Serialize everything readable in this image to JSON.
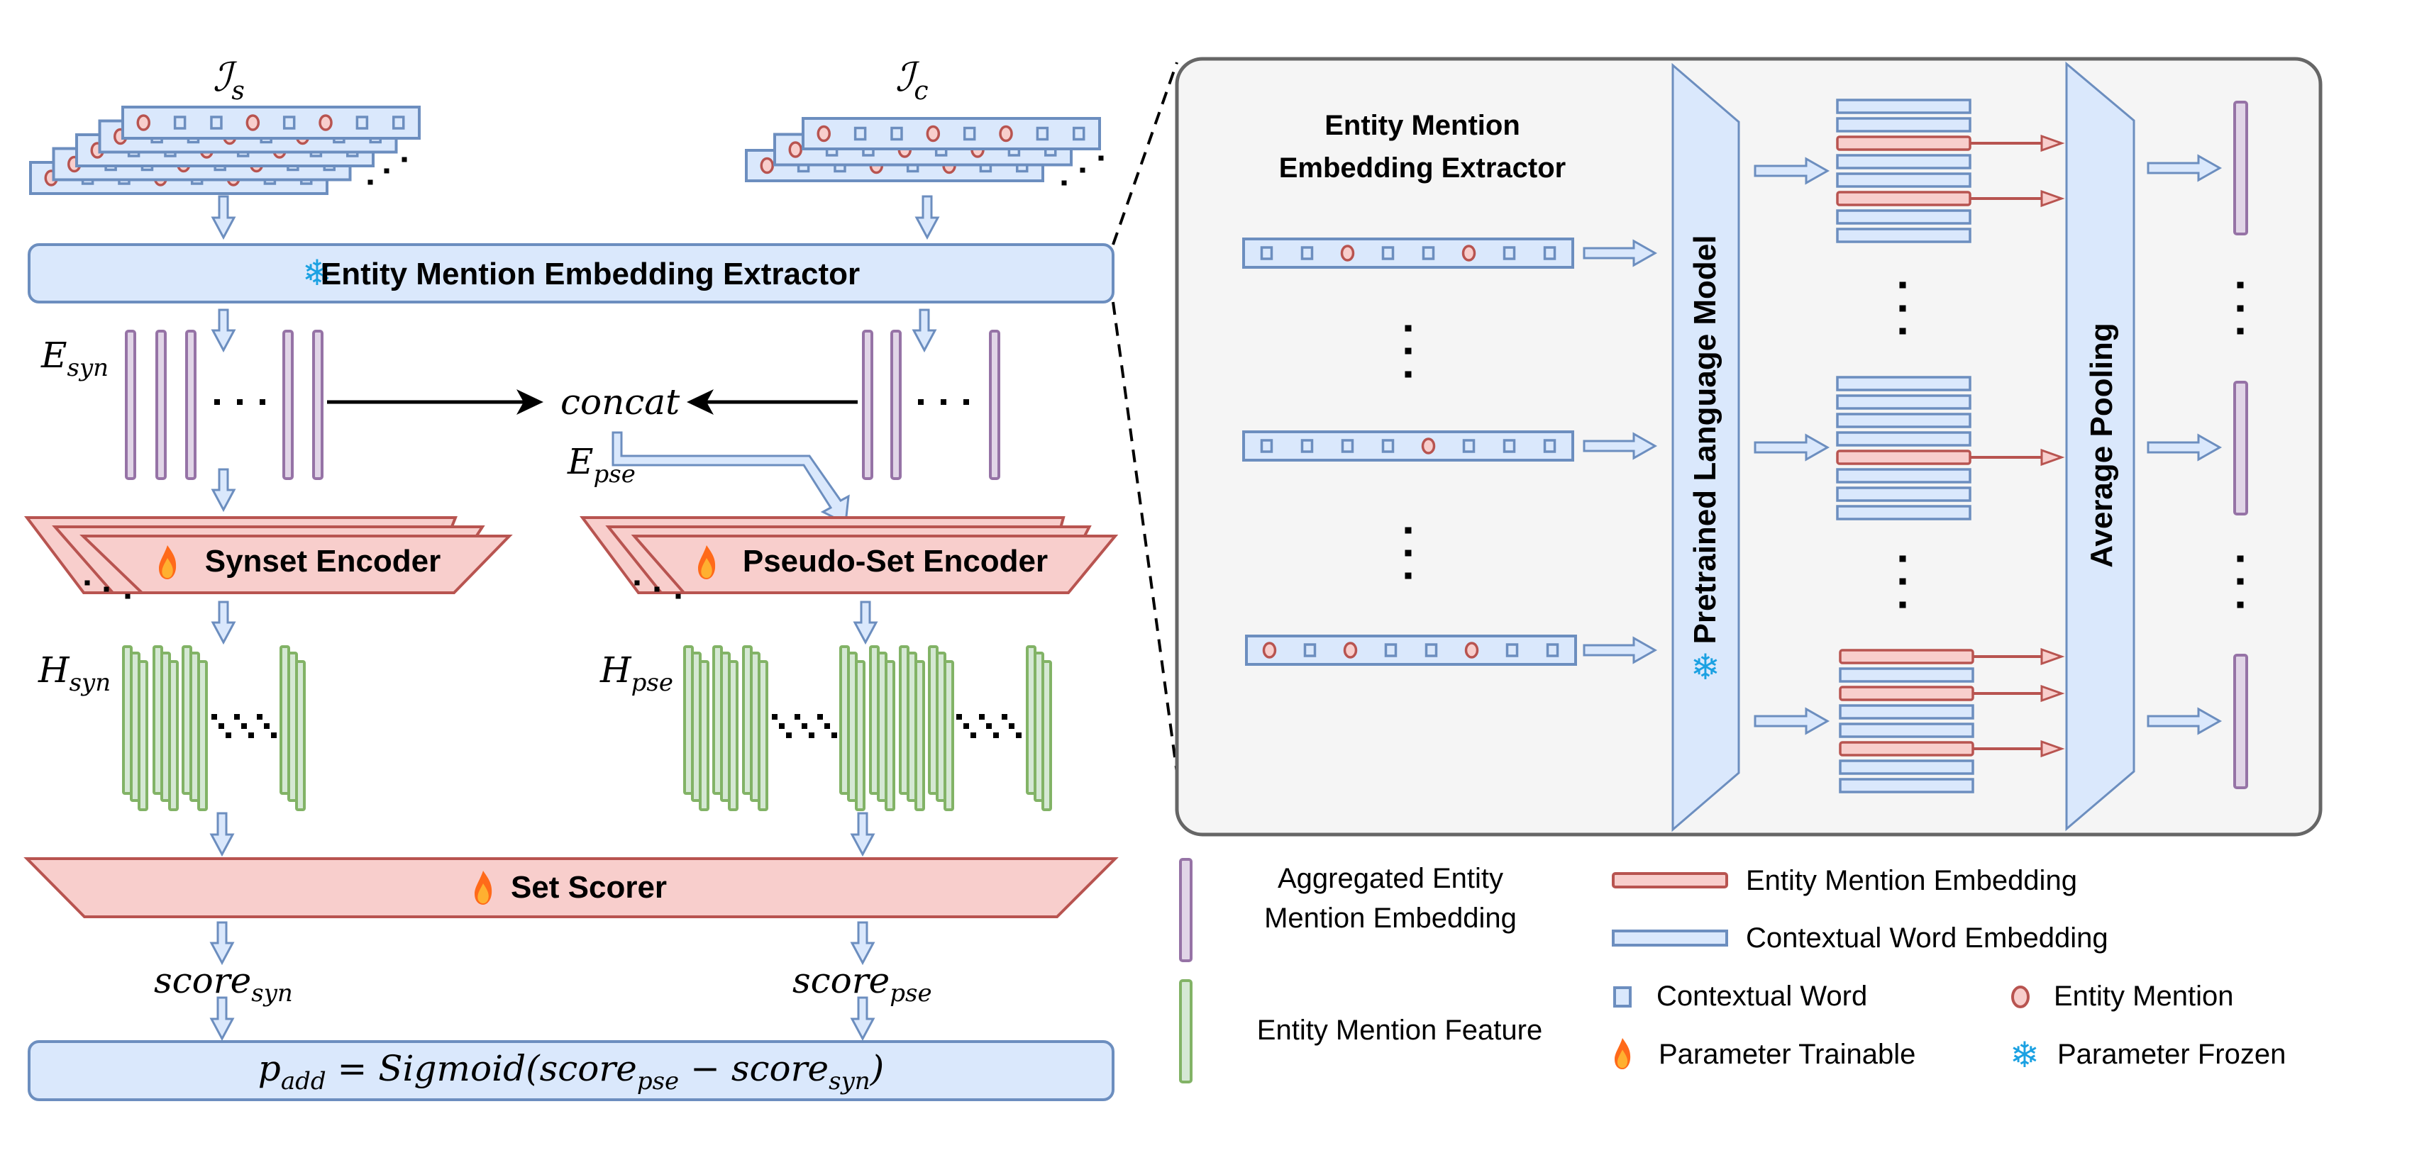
{
  "colors": {
    "blue_fill": "#dae8fc",
    "blue_stroke": "#6c8ebf",
    "red_fill": "#f8cecc",
    "red_stroke": "#b85450",
    "purple_fill": "#e1d5e7",
    "purple_stroke": "#9673a6",
    "green_fill": "#d5e8d4",
    "green_stroke": "#82b366",
    "panel_fill": "#f5f5f5",
    "panel_stroke": "#666666",
    "frozen": "#1ba1e2",
    "fire_outer": "#ff6a1a",
    "fire_inner": "#ffb030"
  },
  "icons": {
    "frozen": "snowflake-icon",
    "trainable": "fire-icon",
    "snowflake_glyph": "❄"
  },
  "inputs": {
    "synset": {
      "base": "ℐ",
      "sub": "s",
      "cards": 5,
      "pattern": "csscscss"
    },
    "candidate": {
      "base": "ℐ",
      "sub": "c",
      "cards": 3,
      "pattern": "csscscss"
    }
  },
  "extractor": {
    "label": "Entity Mention Embedding Extractor"
  },
  "labels": {
    "e_syn": {
      "base": "E",
      "sub": "syn"
    },
    "e_pse": {
      "base": "E",
      "sub": "pse"
    },
    "concat": "concat",
    "h_syn": {
      "base": "H",
      "sub": "syn"
    },
    "h_pse": {
      "base": "H",
      "sub": "pse"
    },
    "score_syn": {
      "base": "score",
      "sub": "syn"
    },
    "score_pse": {
      "base": "score",
      "sub": "pse"
    }
  },
  "synset_encoder": {
    "label": "Synset Encoder"
  },
  "pseudo_encoder": {
    "label": "Pseudo-Set Encoder"
  },
  "set_scorer": {
    "label": "Set Scorer"
  },
  "formula": {
    "p": "p",
    "p_sub": "add",
    "mid": " = Sigmoid(score",
    "s1_sub": "pse",
    "minus": " − score",
    "s2_sub": "syn",
    "end": ")"
  },
  "detail_panel": {
    "title_line1": "Entity Mention",
    "title_line2": "Embedding Extractor",
    "sentences": [
      "sscsscss",
      "sssscsss",
      "cscsscss"
    ],
    "plm_label": "Pretrained Language Model",
    "pool_label": "Average Pooling",
    "token_groups": [
      {
        "rows": 8,
        "mentions": [
          2,
          5
        ]
      },
      {
        "rows": 8,
        "mentions": [
          4
        ]
      },
      {
        "rows": 8,
        "mentions": [
          0,
          2,
          5
        ]
      }
    ]
  },
  "legend": {
    "aggregated_line1": "Aggregated Entity",
    "aggregated_line2": "Mention Embedding",
    "feature": "Entity Mention Feature",
    "mention_embedding": "Entity Mention Embedding",
    "contextual_embedding": "Contextual Word Embedding",
    "contextual_word": "Contextual Word",
    "entity_mention": "Entity Mention",
    "trainable": "Parameter Trainable",
    "frozen": "Parameter Frozen"
  }
}
